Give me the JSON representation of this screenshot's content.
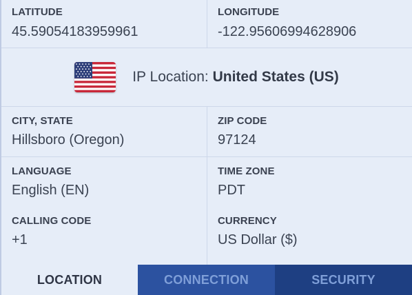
{
  "location": {
    "latitude_label": "LATITUDE",
    "latitude_value": "45.59054183959961",
    "longitude_label": "LONGITUDE",
    "longitude_value": "-122.95606994628906",
    "ip_prefix": "IP Location: ",
    "ip_country": "United States (US)",
    "flag_icon": "us-flag-icon",
    "city_label": "CITY, STATE",
    "city_value": "Hillsboro (Oregon)",
    "zip_label": "ZIP CODE",
    "zip_value": "97124",
    "language_label": "LANGUAGE",
    "language_value": "English (EN)",
    "timezone_label": "TIME ZONE",
    "timezone_value": "PDT",
    "calling_label": "CALLING CODE",
    "calling_value": "+1",
    "currency_label": "CURRENCY",
    "currency_value": "US Dollar ($)"
  },
  "tabs": [
    {
      "label": "LOCATION",
      "active": true
    },
    {
      "label": "CONNECTION",
      "active": false
    },
    {
      "label": "SECURITY",
      "active": false
    }
  ],
  "colors": {
    "panel_bg": "#e6edf8",
    "tab_connection_bg": "#2c52a0",
    "tab_security_bg": "#1e3f82",
    "tab_inactive_text": "#7f9fd8"
  }
}
